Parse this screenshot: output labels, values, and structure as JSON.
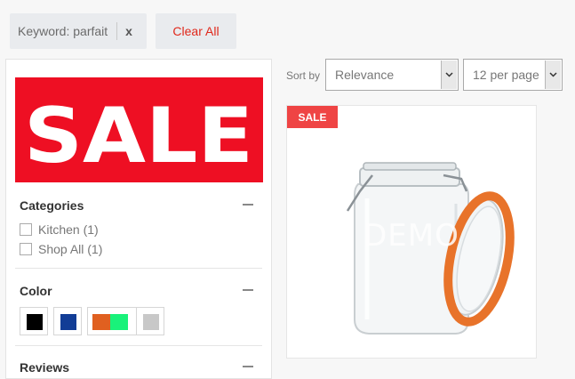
{
  "filters": {
    "keyword_chip": "Keyword: parfait",
    "remove_label": "x",
    "clear_all": "Clear All"
  },
  "sidebar": {
    "banner_text": "SALE",
    "categories": {
      "title": "Categories",
      "items": [
        {
          "label": "Kitchen (1)"
        },
        {
          "label": "Shop All (1)"
        }
      ]
    },
    "color": {
      "title": "Color",
      "swatches": [
        {
          "name": "black",
          "colors": [
            "#000000"
          ]
        },
        {
          "name": "blue",
          "colors": [
            "#123d96"
          ]
        },
        {
          "name": "orange-green",
          "colors": [
            "#e06020",
            "#19f27a"
          ]
        },
        {
          "name": "gray",
          "colors": [
            "#c8c8c8"
          ]
        }
      ]
    },
    "reviews": {
      "title": "Reviews"
    }
  },
  "toolbar": {
    "sort_label": "Sort by",
    "sort_value": "Relevance",
    "per_page_value": "12 per page"
  },
  "product": {
    "badge": "SALE",
    "watermark": "DEMO",
    "image_icon": "glass-jar-with-orange-seal"
  }
}
